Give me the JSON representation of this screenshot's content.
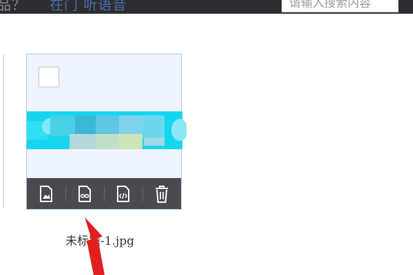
{
  "header": {
    "left_text": "品？",
    "left_accent_text": "在门 听语音",
    "search_placeholder": "请输入搜索内容"
  },
  "file_card": {
    "filename": "未标题-1.jpg",
    "actions": [
      {
        "name": "image-file-icon"
      },
      {
        "name": "link-file-icon"
      },
      {
        "name": "code-file-icon"
      },
      {
        "name": "trash-icon"
      }
    ]
  },
  "colors": {
    "topbar_bg": "#2d2d31",
    "card_bg": "#eef4fd",
    "card_border": "#a9c4e2",
    "action_bar_bg": "#4a4b4f",
    "arrow": "#e02020"
  }
}
